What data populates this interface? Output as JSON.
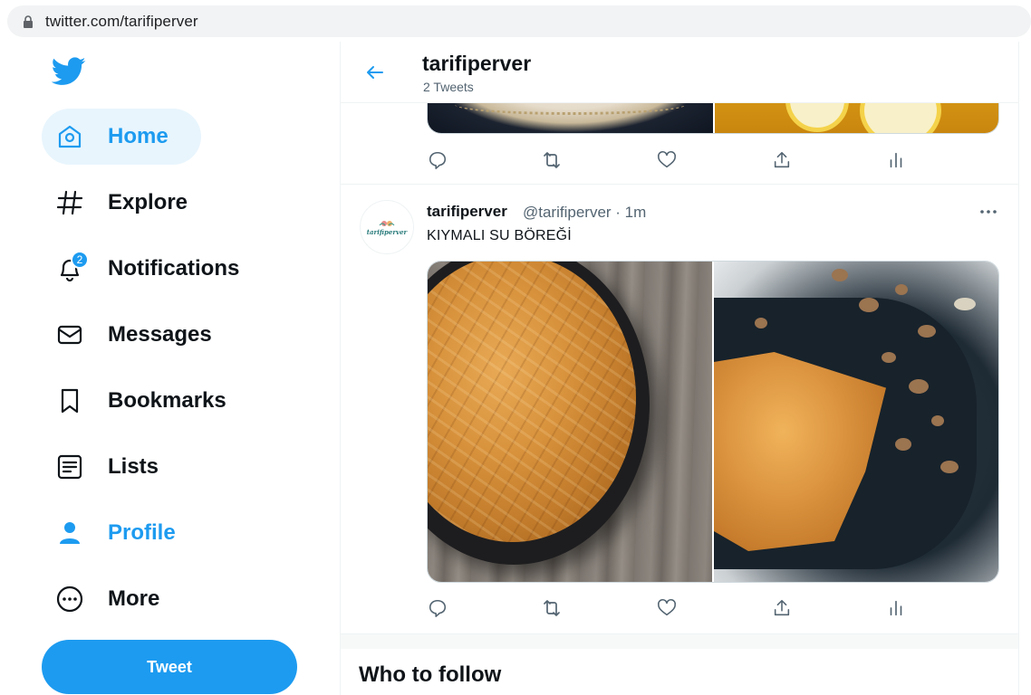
{
  "browser": {
    "url": "twitter.com/tarifiperver"
  },
  "sidebar": {
    "items": [
      {
        "label": "Home"
      },
      {
        "label": "Explore"
      },
      {
        "label": "Notifications",
        "badge": "2"
      },
      {
        "label": "Messages"
      },
      {
        "label": "Bookmarks"
      },
      {
        "label": "Lists"
      },
      {
        "label": "Profile"
      },
      {
        "label": "More"
      }
    ],
    "tweet_button": "Tweet"
  },
  "header": {
    "title": "tarifiperver",
    "subtitle": "2 Tweets"
  },
  "tweet": {
    "name": "tarifiperver",
    "handle_time": "@tarifiperver · 1m",
    "text": "KIYMALI SU BÖREĞİ",
    "avatar_text": "tarifiperver"
  },
  "who_to_follow": {
    "title": "Who to follow"
  },
  "colors": {
    "accent": "#1d9bf0",
    "active_bg": "#e8f5fd",
    "secondary_text": "#536471"
  },
  "icons": [
    "lock-icon",
    "twitter-logo-icon",
    "home-icon",
    "hashtag-icon",
    "bell-icon",
    "envelope-icon",
    "bookmark-icon",
    "list-icon",
    "person-icon",
    "more-circle-icon",
    "back-arrow-icon",
    "reply-icon",
    "retweet-icon",
    "like-icon",
    "share-icon",
    "analytics-icon",
    "more-dots-icon"
  ]
}
